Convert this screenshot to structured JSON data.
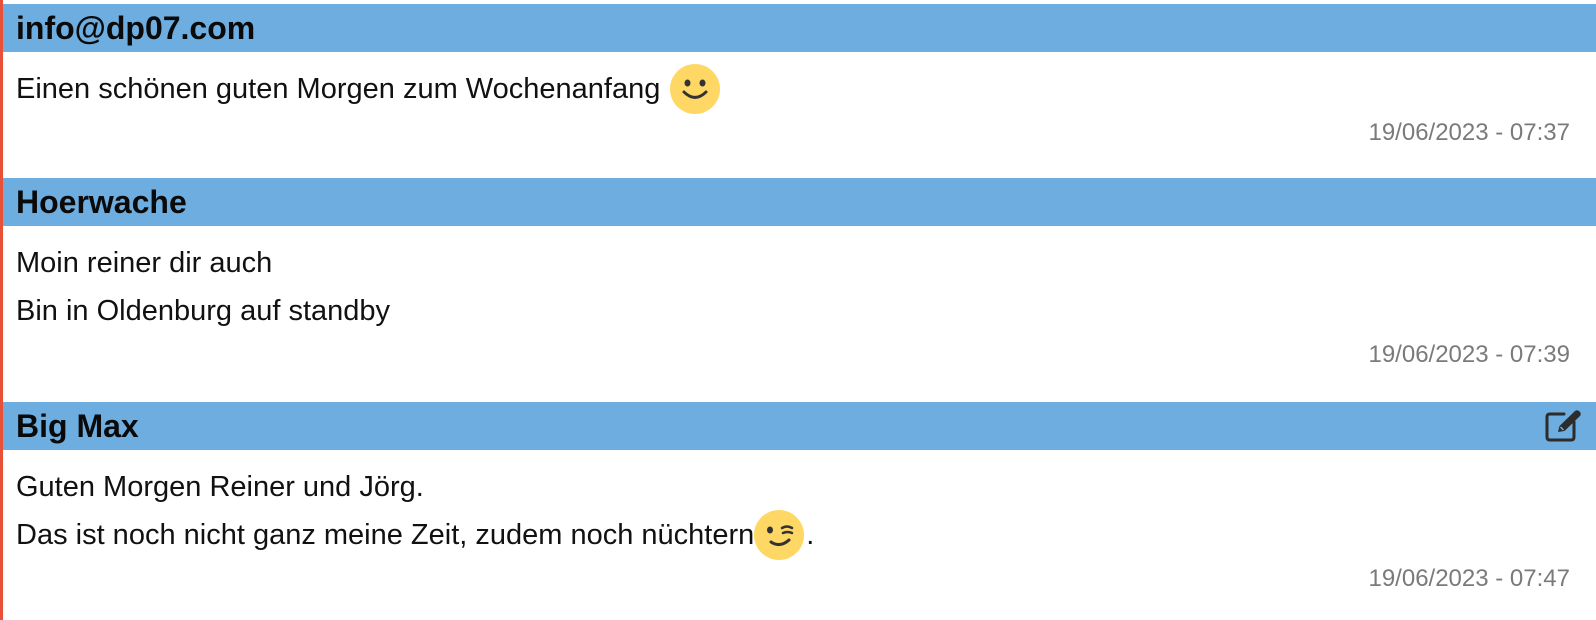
{
  "messages": [
    {
      "author": "info@dp07.com",
      "lines": [
        "Einen schönen guten Morgen zum Wochenanfang"
      ],
      "emoji": "smiling-face-icon",
      "timestamp": "19/06/2023 - 07:37"
    },
    {
      "author": "Hoerwache",
      "lines": [
        "Moin reiner dir auch",
        "Bin in Oldenburg auf standby"
      ],
      "timestamp": "19/06/2023 - 07:39"
    },
    {
      "author": "Big Max",
      "edit_icon": "edit-note-icon",
      "lines": [
        "Guten Morgen Reiner und Jörg.",
        "Das ist noch nicht ganz meine Zeit, zudem noch nüchtern",
        "."
      ],
      "emoji": "winking-face-icon",
      "timestamp": "19/06/2023 - 07:47"
    }
  ],
  "colors": {
    "header_bg": "#6daddf",
    "left_edge": "#e8503a",
    "timestamp": "#7a7a7a",
    "emoji_face": "#ffd764"
  }
}
